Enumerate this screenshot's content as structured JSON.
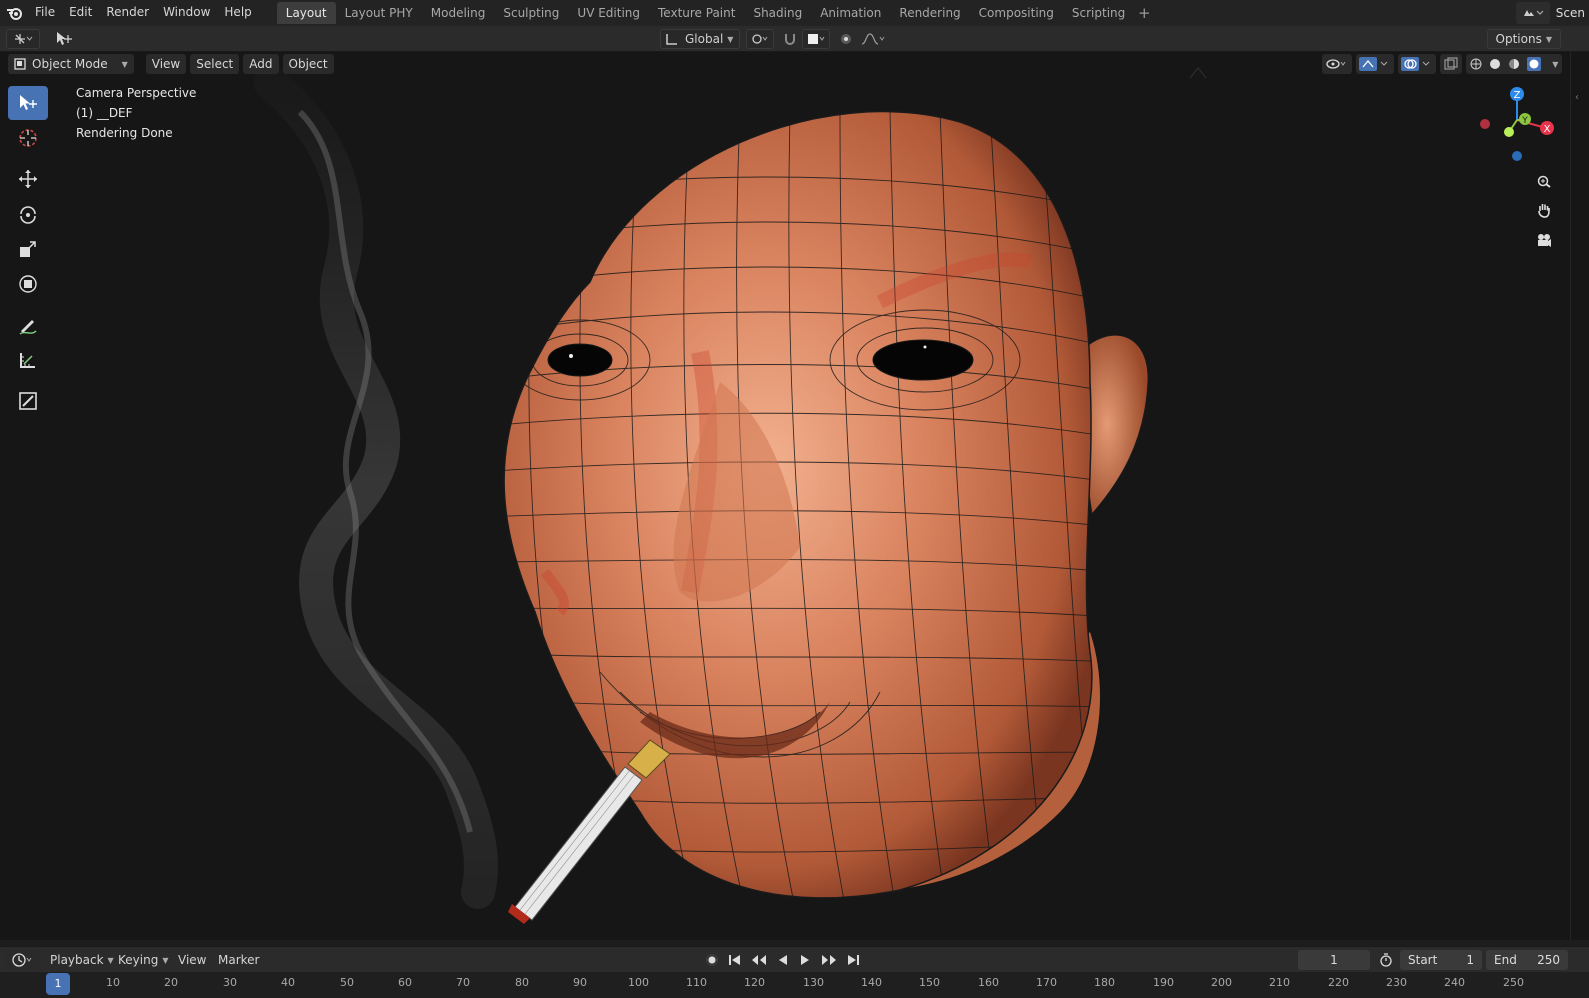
{
  "topbar": {
    "menus": [
      "File",
      "Edit",
      "Render",
      "Window",
      "Help"
    ],
    "workspace_tabs": [
      "Layout",
      "Layout PHY",
      "Modeling",
      "Sculpting",
      "UV Editing",
      "Texture Paint",
      "Shading",
      "Animation",
      "Rendering",
      "Compositing",
      "Scripting"
    ],
    "active_tab": "Layout",
    "scene_label": "Scen"
  },
  "tool_header": {
    "orientation": "Global",
    "options_label": "Options"
  },
  "viewport_header": {
    "mode": "Object Mode",
    "menus": [
      "View",
      "Select",
      "Add",
      "Object"
    ]
  },
  "viewport_overlay": {
    "line1": "Camera Perspective",
    "line2": "(1) __DEF",
    "line3": "Rendering Done"
  },
  "gizmo": {
    "z": "Z",
    "y": "Y",
    "x": "X"
  },
  "timeline": {
    "menus": [
      "Playback",
      "Keying",
      "View",
      "Marker"
    ],
    "current_frame": "1",
    "start_label": "Start",
    "start_value": "1",
    "end_label": "End",
    "end_value": "250",
    "ruler": [
      "1",
      "10",
      "20",
      "30",
      "40",
      "50",
      "60",
      "70",
      "80",
      "90",
      "100",
      "110",
      "120",
      "130",
      "140",
      "150",
      "160",
      "170",
      "180",
      "190",
      "200",
      "210",
      "220",
      "230",
      "240",
      "250"
    ]
  },
  "colors": {
    "accent": "#4772b3",
    "skin": "#d9825e",
    "axis_x": "#e6344b",
    "axis_y": "#8cc63e",
    "axis_z": "#2d8ceb"
  }
}
